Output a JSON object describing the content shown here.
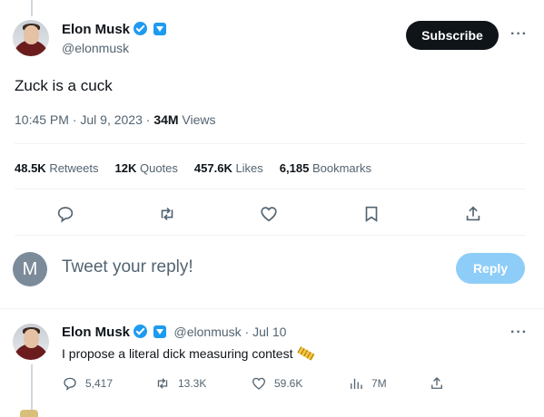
{
  "main_tweet": {
    "author_name": "Elon Musk",
    "handle": "@elonmusk",
    "subscribe_label": "Subscribe",
    "more_label": "···",
    "text": "Zuck is a cuck",
    "time": "10:45 PM · Jul 9, 2023 · ",
    "views_count": "34M",
    "views_label": " Views",
    "stats": [
      {
        "value": "48.5K",
        "label": " Retweets"
      },
      {
        "value": "12K",
        "label": " Quotes"
      },
      {
        "value": "457.6K",
        "label": " Likes"
      },
      {
        "value": "6,185",
        "label": " Bookmarks"
      }
    ],
    "actions": [
      "reply-icon",
      "retweet-icon",
      "like-icon",
      "bookmark-icon",
      "share-icon"
    ]
  },
  "reply_box": {
    "avatar_letter": "M",
    "placeholder": "Tweet your reply!",
    "button_label": "Reply"
  },
  "reply_tweet": {
    "author_name": "Elon Musk",
    "handle_date": "@elonmusk · Jul 10",
    "more_label": "···",
    "text": "I propose a literal dick measuring contest",
    "emoji": "straight-ruler-emoji",
    "stats": {
      "replies": "5,417",
      "retweets": "13.3K",
      "likes": "59.6K",
      "views": "7M"
    }
  },
  "colors": {
    "accent": "#1d9bf0",
    "text_primary": "#0f1419",
    "text_secondary": "#536471",
    "reply_button_disabled": "#8ecdf8"
  }
}
